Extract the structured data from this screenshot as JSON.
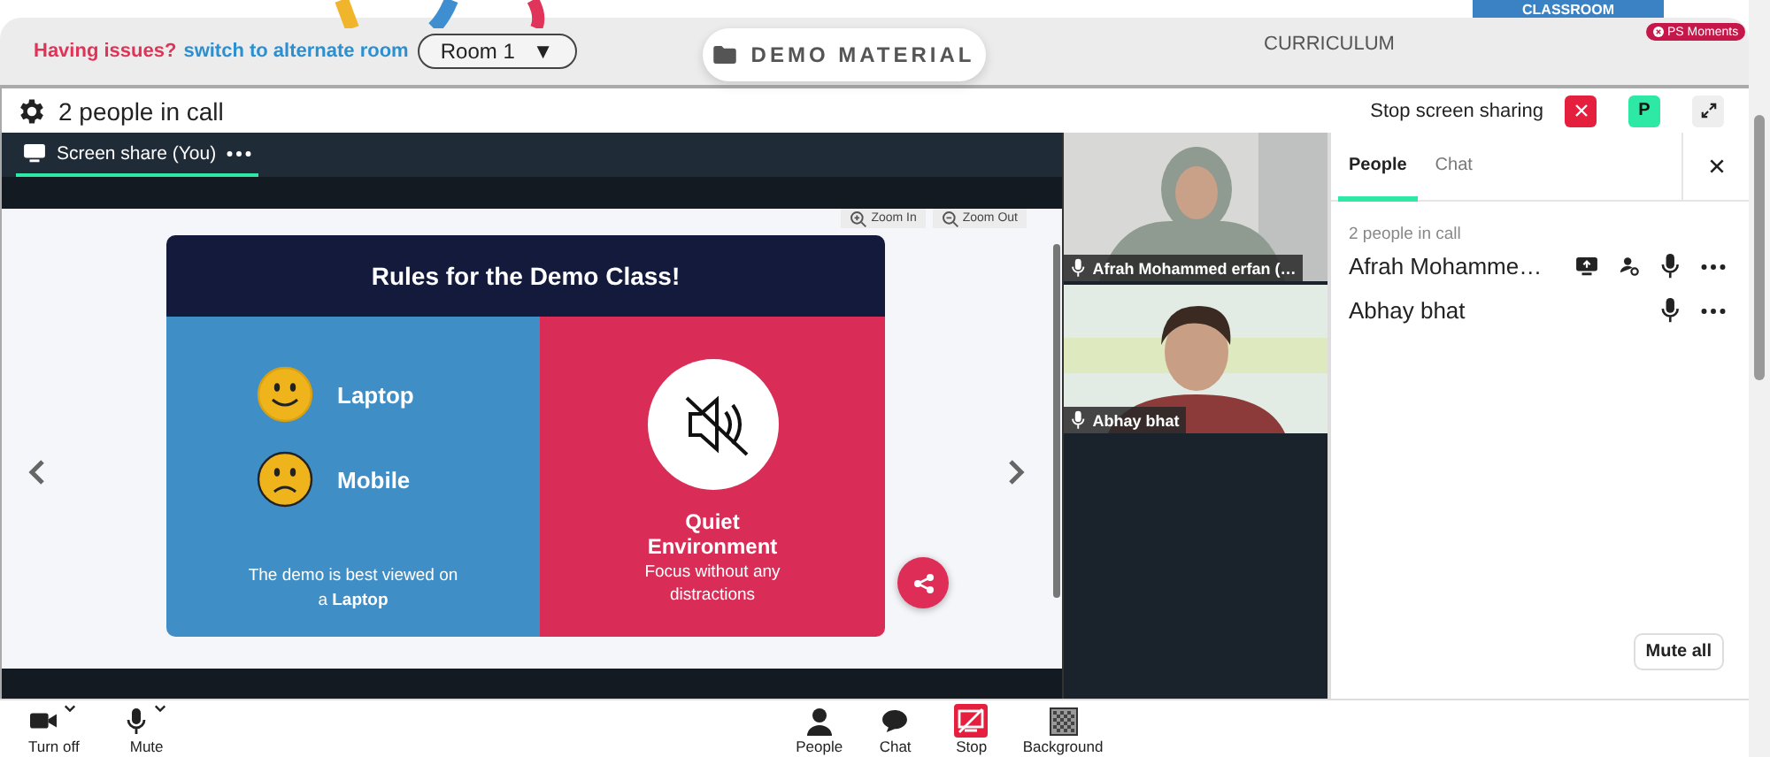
{
  "top_bar": {
    "issue_text": "Having issues?",
    "switch_link": "switch to alternate room",
    "room_select": "Room 1",
    "room_caret": "▼",
    "demo_material": "DEMO MATERIAL",
    "curriculum": "CURRICULUM",
    "ps_moments": "PS Moments",
    "classroom_tab": "CLASSROOM"
  },
  "call_header": {
    "title": "2 people in call",
    "stop_sharing": "Stop screen sharing",
    "avatar": "P"
  },
  "screen_share": {
    "tab": {
      "label": "Screen share (You)",
      "selected": true
    },
    "zoom_buttons": [
      "Zoom In",
      "Zoom Out"
    ],
    "slide": {
      "title": "Rules for the Demo Class!",
      "left_items": [
        {
          "label": "Laptop",
          "kind": "happy"
        },
        {
          "label": "Mobile",
          "kind": "sad"
        }
      ],
      "left_note": "The demo is best viewed on a **Laptop**",
      "right_title": "Quiet Environment",
      "right_note": "Focus without any distractions"
    }
  },
  "videos": [
    {
      "name": "Afrah Mohammed erfan (…",
      "kind": "picture"
    },
    {
      "name": "Abhay bhat",
      "kind": "picture"
    }
  ],
  "people_panel": {
    "tabs": [
      {
        "label": "People",
        "selected": true
      },
      {
        "label": "Chat",
        "selected": false
      }
    ],
    "count": "2 people in call",
    "people": [
      {
        "name": "Afrah Mohamme…",
        "sharing": true,
        "host": true
      },
      {
        "name": "Abhay bhat",
        "sharing": false,
        "host": false
      }
    ],
    "mute_all": "Mute all"
  },
  "toolbar": [
    {
      "label": "Turn off",
      "kind": "camera",
      "dropdown": true
    },
    {
      "label": "Mute",
      "kind": "mic",
      "dropdown": true
    },
    {
      "label": "People",
      "kind": "people",
      "dropdown": false
    },
    {
      "label": "Chat",
      "kind": "chat",
      "dropdown": false
    },
    {
      "label": "Stop",
      "kind": "stop-share",
      "dropdown": false
    },
    {
      "label": "Background",
      "kind": "background",
      "dropdown": false
    }
  ]
}
